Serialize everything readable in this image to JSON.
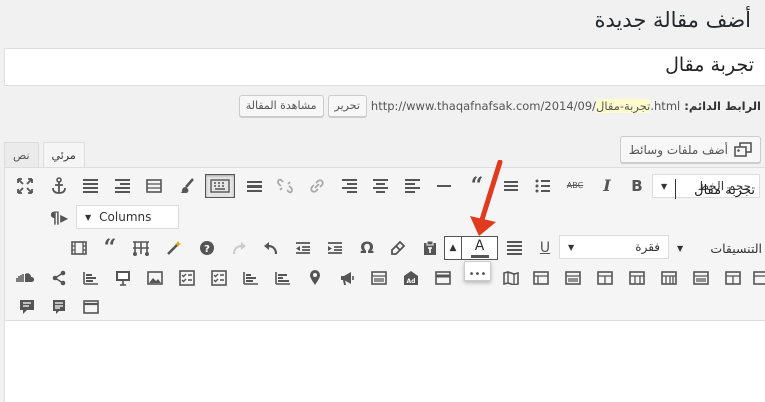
{
  "page": {
    "title": "أضف مقالة جديدة"
  },
  "post": {
    "title_value": "تجربة مقال",
    "permalink_label": "الرابط الدائم:",
    "permalink_prefix": "http://www.thaqafnafsak.com/2014/09/",
    "permalink_slug": "تجربة-مقال",
    "permalink_suffix": ".html",
    "edit_label": "تحرير",
    "view_label": "مشاهدة المقالة"
  },
  "editor": {
    "add_media_label": "أضف ملفات وسائط",
    "tabs": [
      {
        "label": "نص",
        "active": false
      },
      {
        "label": "مرئي",
        "active": true
      }
    ],
    "font_size_select": "حجم الخط",
    "columns_select": "Columns",
    "format_label": "التنسيقات",
    "paragraph_select": "فقرة",
    "content_text": "تجربة مقال"
  },
  "colors": {
    "annotation_arrow": "#e23a1e",
    "toolbar_bg": "#f5f5f5",
    "icon": "#555555"
  },
  "icons": {
    "row1": [
      "fullscreen-icon",
      "anchor-icon",
      "align-full-icon",
      "align-left-stack-icon",
      "table-icon",
      "brush-icon",
      "keyboard-icon",
      "hr-icon",
      "unlink-icon",
      "link-icon",
      "align-right-icon",
      "align-center-icon",
      "align-left-icon",
      "separator-icon",
      "quote-icon",
      "numbered-list-icon",
      "bullet-list-icon",
      "strikethrough-icon",
      "italic-icon",
      "bold-icon"
    ],
    "row2": [
      "paragraph-marks-icon"
    ],
    "row3": [
      "video-icon",
      "quote-icon",
      "toolbar-icon",
      "magic-wand-icon",
      "help-icon",
      "redo-icon",
      "undo-icon",
      "outdent-icon",
      "indent-icon",
      "omega-icon",
      "eraser-icon",
      "paste-text-icon",
      "text-color-icon",
      "align-justify-icon",
      "underline-icon"
    ],
    "row4": [
      "soundcloud-icon",
      "share-icon",
      "chart-icon",
      "presentation-icon",
      "image-icon",
      "checklist-icon",
      "checklist-icon",
      "bar-chart-icon",
      "bar-chart-icon",
      "map-pin-icon",
      "megaphone-icon",
      "layout-icon",
      "layout-icon",
      "ad-icon",
      "layout-icon",
      "layout-icon",
      "layout-icon",
      "map-icon",
      "layout-icon",
      "layout-icon",
      "layout-icon",
      "layout-icon",
      "layout-icon",
      "layout-icon"
    ],
    "row5": [
      "comment-icon",
      "comment-list-icon",
      "window-icon"
    ]
  }
}
